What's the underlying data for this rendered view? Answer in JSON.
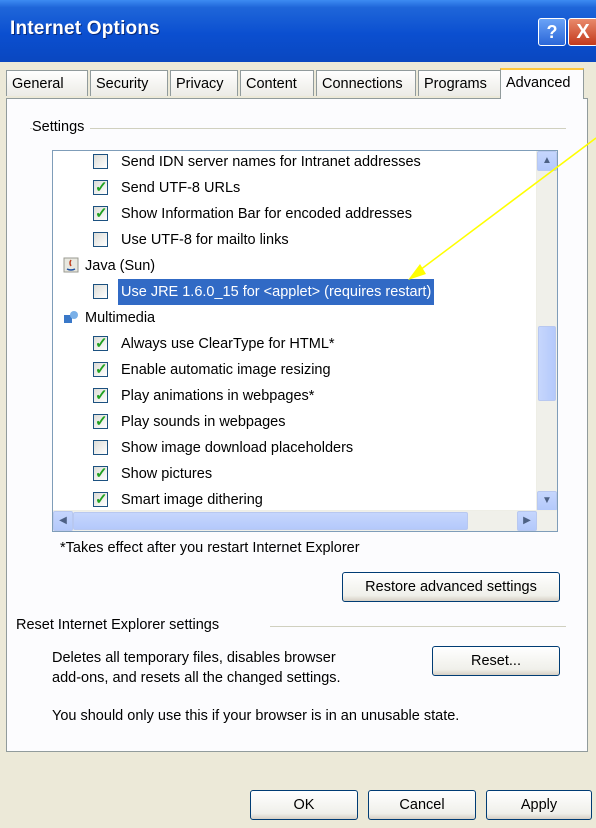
{
  "window": {
    "title": "Internet Options",
    "help_glyph": "?",
    "close_glyph": "X"
  },
  "tabs": [
    "General",
    "Security",
    "Privacy",
    "Content",
    "Connections",
    "Programs",
    "Advanced"
  ],
  "settings": {
    "group_label": "Settings",
    "items": [
      {
        "type": "checkbox",
        "label": "Send IDN server names for Intranet addresses",
        "checked": false
      },
      {
        "type": "checkbox",
        "label": "Send UTF-8 URLs",
        "checked": true
      },
      {
        "type": "checkbox",
        "label": "Show Information Bar for encoded addresses",
        "checked": true
      },
      {
        "type": "checkbox",
        "label": "Use UTF-8 for mailto links",
        "checked": false
      },
      {
        "type": "category",
        "label": "Java (Sun)",
        "icon": "java-icon"
      },
      {
        "type": "checkbox",
        "label": "Use JRE 1.6.0_15 for <applet> (requires restart)",
        "checked": false,
        "selected": true
      },
      {
        "type": "category",
        "label": "Multimedia",
        "icon": "multimedia-icon"
      },
      {
        "type": "checkbox",
        "label": "Always use ClearType for HTML*",
        "checked": true
      },
      {
        "type": "checkbox",
        "label": "Enable automatic image resizing",
        "checked": true
      },
      {
        "type": "checkbox",
        "label": "Play animations in webpages*",
        "checked": true
      },
      {
        "type": "checkbox",
        "label": "Play sounds in webpages",
        "checked": true
      },
      {
        "type": "checkbox",
        "label": "Show image download placeholders",
        "checked": false
      },
      {
        "type": "checkbox",
        "label": "Show pictures",
        "checked": true
      },
      {
        "type": "checkbox",
        "label": "Smart image dithering",
        "checked": true
      }
    ],
    "note": "*Takes effect after you restart Internet Explorer",
    "restore_button": "Restore advanced settings"
  },
  "reset_group": {
    "label": "Reset Internet Explorer settings",
    "description_line1": "Deletes all temporary files, disables browser",
    "description_line2": "add-ons, and resets all the changed settings.",
    "reset_button": "Reset...",
    "warning": "You should only use this if your browser is in an unusable state."
  },
  "footer": {
    "ok": "OK",
    "cancel": "Cancel",
    "apply": "Apply"
  },
  "colors": {
    "selection": "#316ac5",
    "annotation_arrow": "#ffff00",
    "titlebar": "#0a4fd0"
  }
}
